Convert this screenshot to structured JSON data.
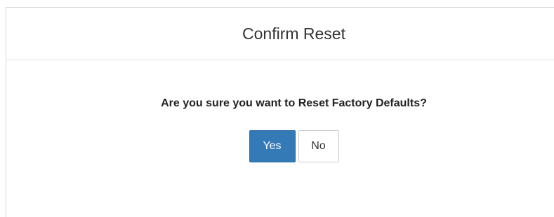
{
  "dialog": {
    "title": "Confirm Reset",
    "message": "Are you sure you want to Reset Factory Defaults?",
    "yes_label": "Yes",
    "no_label": "No"
  },
  "colors": {
    "primary": "#337ab7",
    "primary_border": "#2e6da4",
    "default_border": "#cccccc"
  }
}
